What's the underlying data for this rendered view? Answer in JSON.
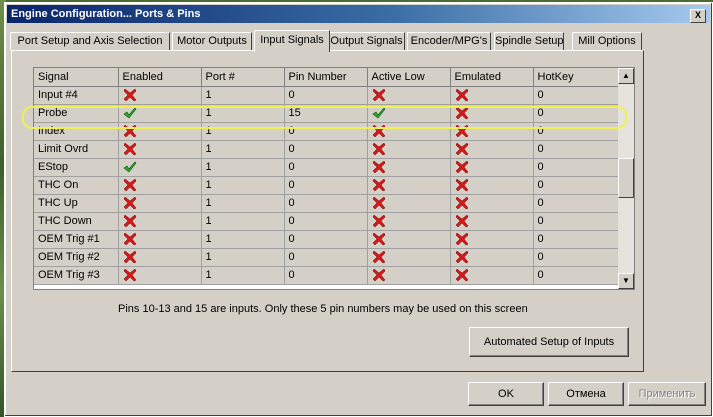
{
  "window": {
    "title": "Engine Configuration... Ports & Pins",
    "close_glyph": "X"
  },
  "tabs": [
    {
      "label": "Port Setup and Axis Selection",
      "active": false
    },
    {
      "label": "Motor Outputs",
      "active": false
    },
    {
      "label": "Input Signals",
      "active": true
    },
    {
      "label": "Output Signals",
      "active": false
    },
    {
      "label": "Encoder/MPG's",
      "active": false
    },
    {
      "label": "Spindle Setup",
      "active": false
    },
    {
      "label": "Mill Options",
      "active": false
    }
  ],
  "grid": {
    "columns": [
      "Signal",
      "Enabled",
      "Port #",
      "Pin Number",
      "Active Low",
      "Emulated",
      "HotKey"
    ],
    "rows": [
      {
        "signal": "Input #4",
        "enabled": "cross-icon",
        "port": "1",
        "pin": "0",
        "active_low": "cross-icon",
        "emulated": "cross-icon",
        "hotkey": "0"
      },
      {
        "signal": "Probe",
        "enabled": "check-icon",
        "port": "1",
        "pin": "15",
        "active_low": "check-icon",
        "emulated": "cross-icon",
        "hotkey": "0"
      },
      {
        "signal": "Index",
        "enabled": "cross-icon",
        "port": "1",
        "pin": "0",
        "active_low": "cross-icon",
        "emulated": "cross-icon",
        "hotkey": "0"
      },
      {
        "signal": "Limit Ovrd",
        "enabled": "cross-icon",
        "port": "1",
        "pin": "0",
        "active_low": "cross-icon",
        "emulated": "cross-icon",
        "hotkey": "0"
      },
      {
        "signal": "EStop",
        "enabled": "check-icon",
        "port": "1",
        "pin": "0",
        "active_low": "cross-icon",
        "emulated": "cross-icon",
        "hotkey": "0"
      },
      {
        "signal": "THC On",
        "enabled": "cross-icon",
        "port": "1",
        "pin": "0",
        "active_low": "cross-icon",
        "emulated": "cross-icon",
        "hotkey": "0"
      },
      {
        "signal": "THC Up",
        "enabled": "cross-icon",
        "port": "1",
        "pin": "0",
        "active_low": "cross-icon",
        "emulated": "cross-icon",
        "hotkey": "0"
      },
      {
        "signal": "THC Down",
        "enabled": "cross-icon",
        "port": "1",
        "pin": "0",
        "active_low": "cross-icon",
        "emulated": "cross-icon",
        "hotkey": "0"
      },
      {
        "signal": "OEM Trig #1",
        "enabled": "cross-icon",
        "port": "1",
        "pin": "0",
        "active_low": "cross-icon",
        "emulated": "cross-icon",
        "hotkey": "0"
      },
      {
        "signal": "OEM Trig #2",
        "enabled": "cross-icon",
        "port": "1",
        "pin": "0",
        "active_low": "cross-icon",
        "emulated": "cross-icon",
        "hotkey": "0"
      },
      {
        "signal": "OEM Trig #3",
        "enabled": "cross-icon",
        "port": "1",
        "pin": "0",
        "active_low": "cross-icon",
        "emulated": "cross-icon",
        "hotkey": "0"
      }
    ]
  },
  "scrollbar": {
    "up_glyph": "▲",
    "down_glyph": "▼"
  },
  "info_text": "Pins 10-13 and 15 are inputs. Only these 5 pin numbers may be used on this screen",
  "buttons": {
    "automated_setup": "Automated Setup of Inputs",
    "ok": "OK",
    "cancel": "Отмена",
    "apply": "Применить"
  },
  "colors": {
    "check": "#22b022",
    "cross": "#d81818",
    "highlight": "#f0f050",
    "title_start": "#0a246a",
    "title_end": "#a6caf0"
  }
}
